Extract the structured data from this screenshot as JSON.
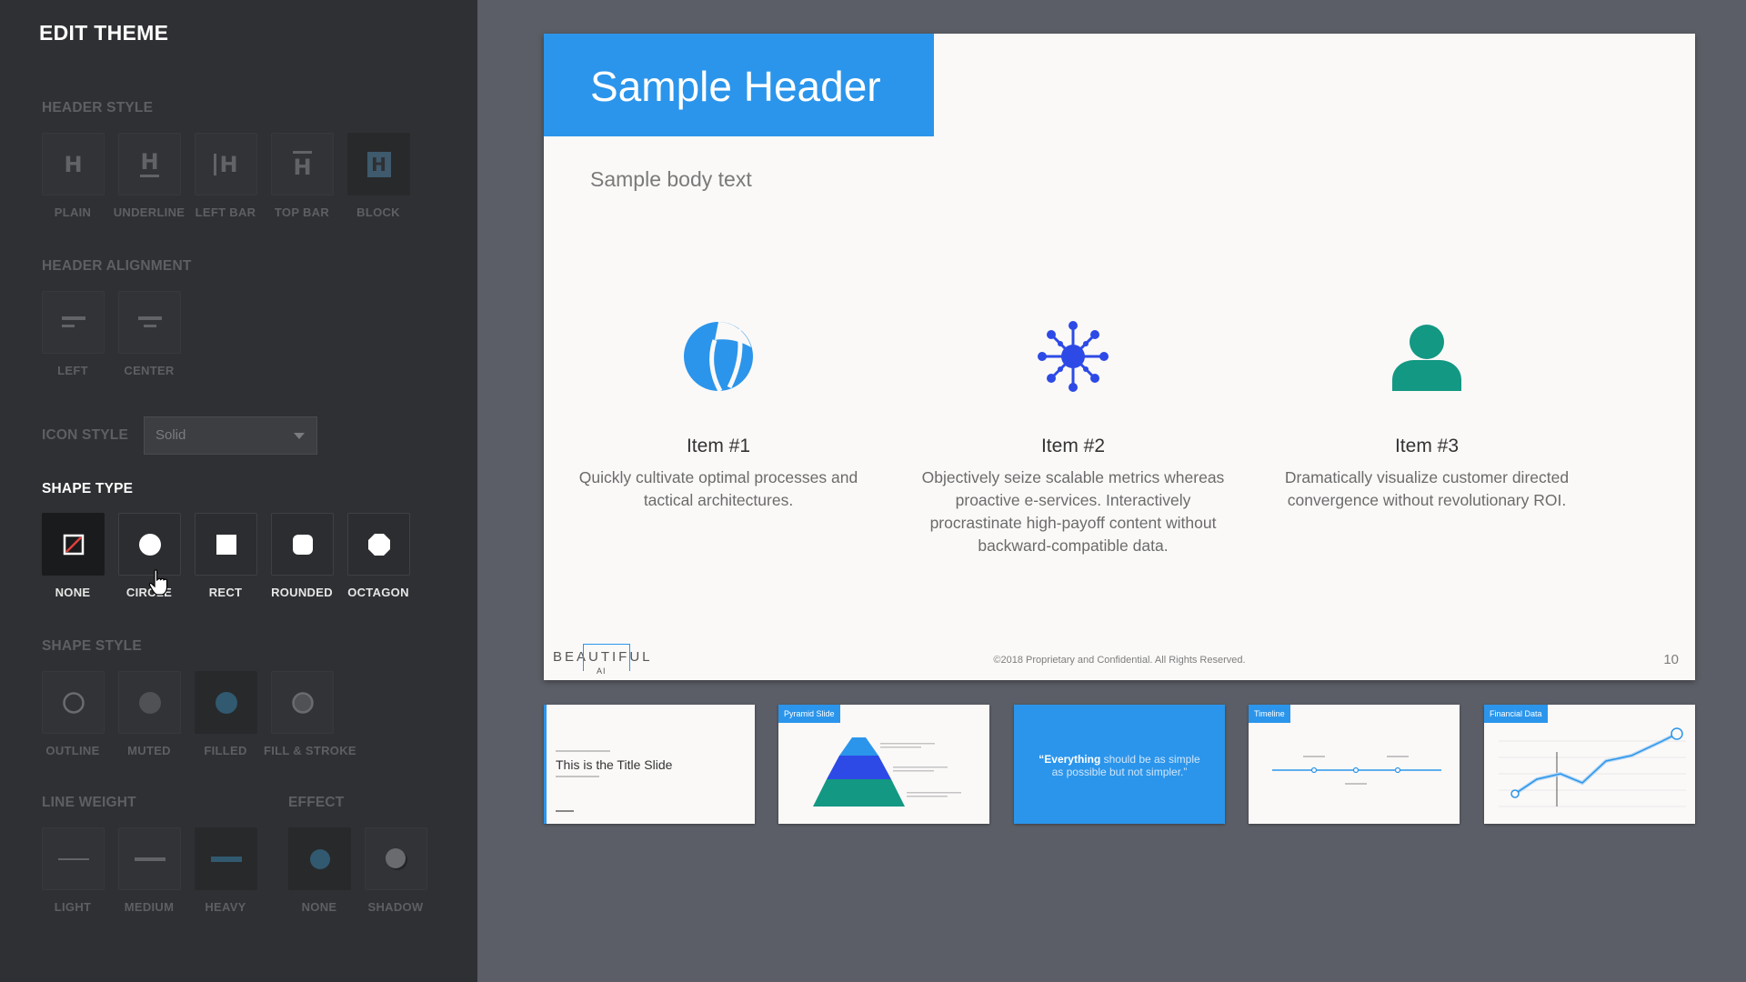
{
  "panel": {
    "title": "EDIT THEME"
  },
  "sections": {
    "header_style": "HEADER STYLE",
    "header_alignment": "HEADER ALIGNMENT",
    "icon_style": "ICON STYLE",
    "shape_type": "SHAPE TYPE",
    "shape_style": "SHAPE STYLE",
    "line_weight": "LINE WEIGHT",
    "effect": "EFFECT"
  },
  "header_style_options": [
    "PLAIN",
    "UNDERLINE",
    "LEFT BAR",
    "TOP BAR",
    "BLOCK"
  ],
  "header_alignment_options": [
    "LEFT",
    "CENTER"
  ],
  "icon_style": {
    "selected": "Solid"
  },
  "shape_type_options": [
    "NONE",
    "CIRCLE",
    "RECT",
    "ROUNDED",
    "OCTAGON"
  ],
  "shape_style_options": [
    "OUTLINE",
    "MUTED",
    "FILLED",
    "FILL & STROKE"
  ],
  "line_weight_options": [
    "LIGHT",
    "MEDIUM",
    "HEAVY"
  ],
  "effect_options": [
    "NONE",
    "SHADOW"
  ],
  "colors": {
    "accent": "#2b95eb",
    "icon_dark_blue": "#2d4ae6",
    "icon_teal": "#139883"
  },
  "slide": {
    "header": "Sample Header",
    "body": "Sample body text",
    "items": [
      {
        "icon": "beach-ball-icon",
        "title": "Item #1",
        "desc": "Quickly cultivate optimal processes and tactical architectures."
      },
      {
        "icon": "network-hub-icon",
        "title": "Item #2",
        "desc": "Objectively seize scalable metrics whereas proactive e-services. Interactively procrastinate high-payoff content without backward-compatible data."
      },
      {
        "icon": "person-icon",
        "title": "Item #3",
        "desc": "Dramatically visualize customer directed convergence without revolutionary ROI."
      }
    ],
    "logo": "BEAUTIFUL",
    "logo_sub": "AI",
    "footer": "©2018 Proprietary and Confidential. All Rights Reserved.",
    "page_number": "10"
  },
  "thumbnails": [
    {
      "title": "This is the Title Slide"
    },
    {
      "tag": "Pyramid Slide"
    },
    {
      "quote_bold": "“Everything",
      "quote_rest": " should be as simple as possible but not simpler.”"
    },
    {
      "tag": "Timeline"
    },
    {
      "tag": "Financial Data"
    }
  ]
}
